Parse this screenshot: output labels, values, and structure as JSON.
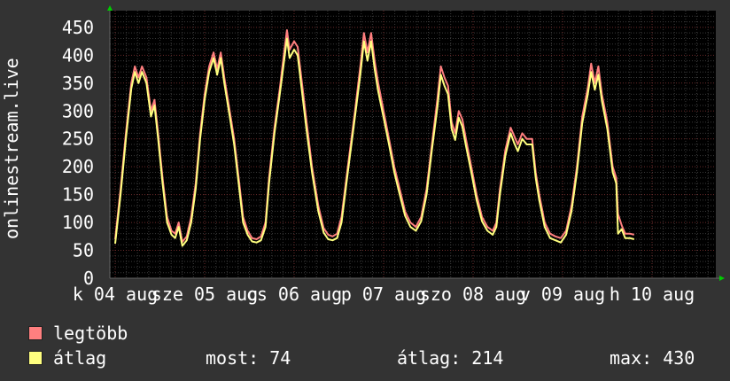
{
  "chart_data": {
    "type": "line",
    "ylabel": "onlinestream.live",
    "ylim": [
      0,
      480
    ],
    "yticks": [
      0,
      50,
      100,
      150,
      200,
      250,
      300,
      350,
      400,
      450
    ],
    "xlim": [
      0,
      7
    ],
    "x_ticks": [
      {
        "label": "k 04 aug",
        "x": 0.0
      },
      {
        "label": "sze 05 aug",
        "x": 1.0
      },
      {
        "label": "cs 06 aug",
        "x": 2.0
      },
      {
        "label": "p 07 aug",
        "x": 3.0
      },
      {
        "label": "szo 08 aug",
        "x": 4.0
      },
      {
        "label": "v 09 aug",
        "x": 5.0
      },
      {
        "label": "h 10 aug",
        "x": 6.0
      }
    ],
    "grid": true,
    "series": [
      {
        "name": "legtöbb",
        "color": "#ff7f7f",
        "points": [
          [
            0.0,
            70
          ],
          [
            0.06,
            160
          ],
          [
            0.12,
            260
          ],
          [
            0.18,
            350
          ],
          [
            0.22,
            380
          ],
          [
            0.26,
            360
          ],
          [
            0.3,
            380
          ],
          [
            0.35,
            360
          ],
          [
            0.4,
            300
          ],
          [
            0.44,
            320
          ],
          [
            0.48,
            260
          ],
          [
            0.53,
            180
          ],
          [
            0.58,
            110
          ],
          [
            0.63,
            85
          ],
          [
            0.67,
            80
          ],
          [
            0.71,
            100
          ],
          [
            0.75,
            65
          ],
          [
            0.8,
            75
          ],
          [
            0.85,
            110
          ],
          [
            0.9,
            170
          ],
          [
            0.95,
            260
          ],
          [
            1.0,
            330
          ],
          [
            1.05,
            380
          ],
          [
            1.1,
            405
          ],
          [
            1.14,
            375
          ],
          [
            1.18,
            405
          ],
          [
            1.22,
            360
          ],
          [
            1.28,
            300
          ],
          [
            1.33,
            250
          ],
          [
            1.38,
            180
          ],
          [
            1.43,
            110
          ],
          [
            1.48,
            85
          ],
          [
            1.53,
            72
          ],
          [
            1.58,
            70
          ],
          [
            1.63,
            75
          ],
          [
            1.68,
            100
          ],
          [
            1.72,
            180
          ],
          [
            1.78,
            270
          ],
          [
            1.84,
            340
          ],
          [
            1.88,
            395
          ],
          [
            1.92,
            445
          ],
          [
            1.95,
            410
          ],
          [
            2.0,
            425
          ],
          [
            2.04,
            415
          ],
          [
            2.08,
            360
          ],
          [
            2.14,
            280
          ],
          [
            2.2,
            200
          ],
          [
            2.27,
            130
          ],
          [
            2.33,
            90
          ],
          [
            2.38,
            78
          ],
          [
            2.43,
            75
          ],
          [
            2.48,
            80
          ],
          [
            2.53,
            110
          ],
          [
            2.6,
            200
          ],
          [
            2.68,
            300
          ],
          [
            2.74,
            380
          ],
          [
            2.78,
            440
          ],
          [
            2.82,
            405
          ],
          [
            2.86,
            440
          ],
          [
            2.9,
            390
          ],
          [
            2.94,
            350
          ],
          [
            3.0,
            300
          ],
          [
            3.06,
            250
          ],
          [
            3.12,
            200
          ],
          [
            3.18,
            160
          ],
          [
            3.24,
            120
          ],
          [
            3.3,
            100
          ],
          [
            3.36,
            92
          ],
          [
            3.42,
            110
          ],
          [
            3.48,
            160
          ],
          [
            3.54,
            240
          ],
          [
            3.6,
            320
          ],
          [
            3.64,
            380
          ],
          [
            3.68,
            360
          ],
          [
            3.72,
            345
          ],
          [
            3.76,
            280
          ],
          [
            3.8,
            260
          ],
          [
            3.84,
            300
          ],
          [
            3.88,
            285
          ],
          [
            3.92,
            250
          ],
          [
            3.98,
            200
          ],
          [
            4.04,
            150
          ],
          [
            4.1,
            110
          ],
          [
            4.16,
            92
          ],
          [
            4.22,
            85
          ],
          [
            4.26,
            100
          ],
          [
            4.3,
            160
          ],
          [
            4.36,
            230
          ],
          [
            4.42,
            270
          ],
          [
            4.46,
            255
          ],
          [
            4.5,
            240
          ],
          [
            4.55,
            260
          ],
          [
            4.6,
            250
          ],
          [
            4.66,
            250
          ],
          [
            4.7,
            190
          ],
          [
            4.74,
            150
          ],
          [
            4.8,
            100
          ],
          [
            4.86,
            80
          ],
          [
            4.92,
            75
          ],
          [
            4.98,
            72
          ],
          [
            5.04,
            85
          ],
          [
            5.1,
            130
          ],
          [
            5.16,
            200
          ],
          [
            5.22,
            290
          ],
          [
            5.28,
            340
          ],
          [
            5.32,
            385
          ],
          [
            5.36,
            350
          ],
          [
            5.4,
            380
          ],
          [
            5.44,
            330
          ],
          [
            5.5,
            280
          ],
          [
            5.56,
            200
          ],
          [
            5.6,
            180
          ],
          [
            5.62,
            115
          ],
          [
            5.66,
            95
          ],
          [
            5.7,
            80
          ],
          [
            5.75,
            80
          ],
          [
            5.8,
            78
          ]
        ]
      },
      {
        "name": "átlag",
        "color": "#ffff7f",
        "points": [
          [
            0.0,
            62
          ],
          [
            0.06,
            150
          ],
          [
            0.12,
            250
          ],
          [
            0.18,
            340
          ],
          [
            0.22,
            370
          ],
          [
            0.26,
            350
          ],
          [
            0.3,
            370
          ],
          [
            0.35,
            350
          ],
          [
            0.4,
            290
          ],
          [
            0.44,
            310
          ],
          [
            0.48,
            250
          ],
          [
            0.53,
            170
          ],
          [
            0.58,
            100
          ],
          [
            0.63,
            78
          ],
          [
            0.67,
            72
          ],
          [
            0.71,
            92
          ],
          [
            0.75,
            58
          ],
          [
            0.8,
            68
          ],
          [
            0.85,
            100
          ],
          [
            0.9,
            160
          ],
          [
            0.95,
            250
          ],
          [
            1.0,
            320
          ],
          [
            1.05,
            370
          ],
          [
            1.1,
            395
          ],
          [
            1.14,
            365
          ],
          [
            1.18,
            395
          ],
          [
            1.22,
            350
          ],
          [
            1.28,
            290
          ],
          [
            1.33,
            240
          ],
          [
            1.38,
            170
          ],
          [
            1.43,
            100
          ],
          [
            1.48,
            78
          ],
          [
            1.53,
            66
          ],
          [
            1.58,
            64
          ],
          [
            1.63,
            68
          ],
          [
            1.68,
            92
          ],
          [
            1.72,
            170
          ],
          [
            1.78,
            260
          ],
          [
            1.84,
            330
          ],
          [
            1.88,
            380
          ],
          [
            1.92,
            430
          ],
          [
            1.95,
            395
          ],
          [
            2.0,
            410
          ],
          [
            2.04,
            400
          ],
          [
            2.08,
            345
          ],
          [
            2.14,
            265
          ],
          [
            2.2,
            190
          ],
          [
            2.27,
            120
          ],
          [
            2.33,
            82
          ],
          [
            2.38,
            70
          ],
          [
            2.43,
            68
          ],
          [
            2.48,
            72
          ],
          [
            2.53,
            100
          ],
          [
            2.6,
            190
          ],
          [
            2.68,
            290
          ],
          [
            2.74,
            365
          ],
          [
            2.78,
            425
          ],
          [
            2.82,
            390
          ],
          [
            2.86,
            425
          ],
          [
            2.9,
            375
          ],
          [
            2.94,
            335
          ],
          [
            3.0,
            288
          ],
          [
            3.06,
            240
          ],
          [
            3.12,
            190
          ],
          [
            3.18,
            150
          ],
          [
            3.24,
            112
          ],
          [
            3.3,
            92
          ],
          [
            3.36,
            85
          ],
          [
            3.42,
            102
          ],
          [
            3.48,
            150
          ],
          [
            3.54,
            230
          ],
          [
            3.6,
            305
          ],
          [
            3.64,
            365
          ],
          [
            3.68,
            345
          ],
          [
            3.72,
            330
          ],
          [
            3.76,
            268
          ],
          [
            3.8,
            248
          ],
          [
            3.84,
            288
          ],
          [
            3.88,
            272
          ],
          [
            3.92,
            238
          ],
          [
            3.98,
            190
          ],
          [
            4.04,
            140
          ],
          [
            4.1,
            102
          ],
          [
            4.16,
            85
          ],
          [
            4.22,
            78
          ],
          [
            4.26,
            92
          ],
          [
            4.3,
            150
          ],
          [
            4.36,
            220
          ],
          [
            4.42,
            260
          ],
          [
            4.46,
            242
          ],
          [
            4.5,
            228
          ],
          [
            4.55,
            250
          ],
          [
            4.6,
            240
          ],
          [
            4.66,
            240
          ],
          [
            4.7,
            180
          ],
          [
            4.74,
            140
          ],
          [
            4.8,
            92
          ],
          [
            4.86,
            72
          ],
          [
            4.92,
            68
          ],
          [
            4.98,
            64
          ],
          [
            5.04,
            78
          ],
          [
            5.1,
            120
          ],
          [
            5.16,
            190
          ],
          [
            5.22,
            278
          ],
          [
            5.28,
            328
          ],
          [
            5.32,
            370
          ],
          [
            5.36,
            338
          ],
          [
            5.4,
            365
          ],
          [
            5.44,
            318
          ],
          [
            5.5,
            268
          ],
          [
            5.56,
            190
          ],
          [
            5.6,
            170
          ],
          [
            5.62,
            80
          ],
          [
            5.66,
            88
          ],
          [
            5.7,
            72
          ],
          [
            5.75,
            72
          ],
          [
            5.8,
            70
          ]
        ]
      }
    ]
  },
  "legend": {
    "items": [
      {
        "label": "legtöbb",
        "color": "#ff7f7f"
      },
      {
        "label": "átlag",
        "color": "#ffff7f"
      }
    ],
    "stats": {
      "now_label": "most: 74",
      "avg_label": "átlag: 214",
      "max_label": "max: 430"
    }
  }
}
